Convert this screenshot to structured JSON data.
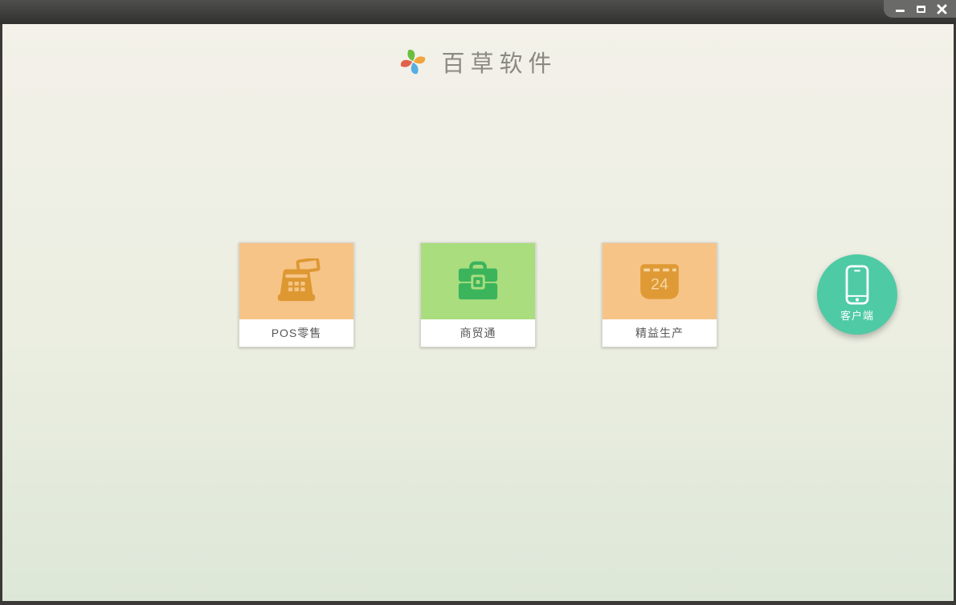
{
  "window_controls": {
    "minimize_icon": "minimize-icon",
    "maximize_icon": "maximize-icon",
    "close_icon": "close-icon"
  },
  "header": {
    "app_name": "百草软件",
    "logo": "pinwheel-logo",
    "logo_colors": {
      "top": "#6abf3e",
      "right": "#f0a43c",
      "bottom": "#58aee0",
      "left": "#e2604b"
    }
  },
  "products": [
    {
      "label": "POS零售",
      "icon": "cash-register-icon",
      "tile_color": "#f6c487",
      "icon_color": "#dd9832"
    },
    {
      "label": "商贸通",
      "icon": "briefcase-icon",
      "tile_color": "#a9dd7e",
      "icon_color": "#3cb45c"
    },
    {
      "label": "精益生产",
      "icon": "calendar-icon",
      "calendar_day": "24",
      "tile_color": "#f6c487",
      "icon_color": "#e09a35"
    }
  ],
  "client_button": {
    "label": "客户端",
    "icon": "smartphone-icon",
    "color": "#4ecaa5"
  },
  "colors": {
    "bg_top": "#f3f1e9",
    "bg_bottom": "#dde7d8",
    "titlebar": "#3c3c3a",
    "controls_tab": "#6a6a68",
    "card_label_text": "#57575a",
    "title_text": "#8a8a82"
  }
}
